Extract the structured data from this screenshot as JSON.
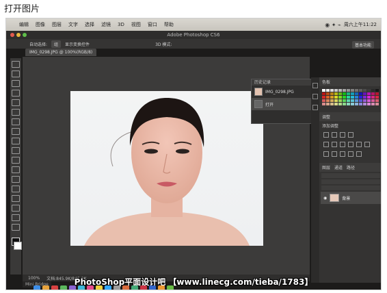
{
  "caption": "打开图片",
  "menubar": {
    "items": [
      "编辑",
      "图像",
      "图层",
      "文字",
      "选择",
      "滤镜",
      "3D",
      "视图",
      "窗口",
      "帮助"
    ],
    "clock": "周六上午11:22"
  },
  "photoshop": {
    "title": "Adobe Photoshop CS6",
    "options": {
      "auto_select": "自动选择:",
      "auto_select_value": "组",
      "show_transform": "显示变换控件",
      "mode_3d": "3D 模式:"
    },
    "essentials": "基本功能",
    "doc_tab": "IMG_0298.JPG @ 100%(RGB/8)",
    "history": {
      "title": "历史记录",
      "snapshot": "IMG_0298.JPG",
      "step": "打开"
    },
    "panels": {
      "swatches_tab": "色板",
      "adjust_tab": "调整",
      "add_adjust": "添加调整",
      "layers_tab": "图层",
      "channels_tab": "通道",
      "paths_tab": "路径",
      "layer_name": "背景"
    },
    "status": {
      "zoom": "100%",
      "doc": "文档:845.9K/845.9K"
    },
    "mini_bridge": "Mini Bridge"
  },
  "watermark": "PhotoShop平面设计吧 【www.linecg.com/tieba/1783】",
  "colors": {
    "ps_dark": "#3c3b3a",
    "menubar": "#d9d7d0"
  }
}
